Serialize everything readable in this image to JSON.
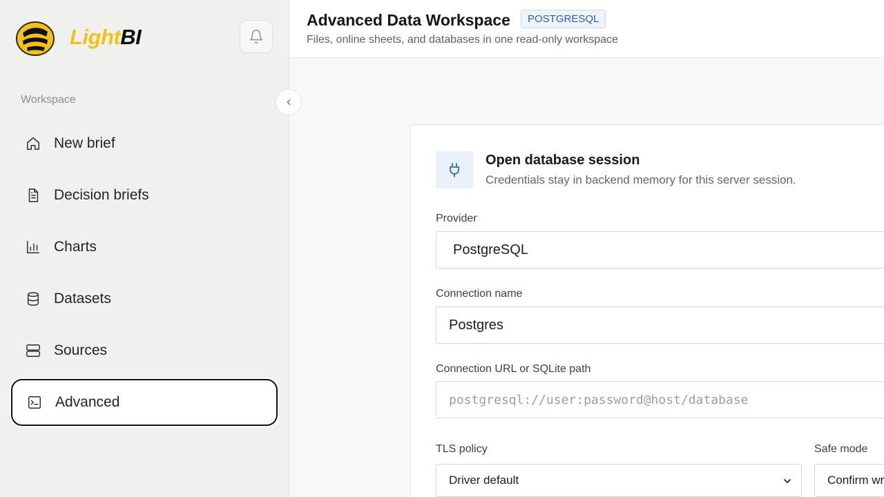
{
  "brand": {
    "name_light": "Light",
    "name_bi": "BI"
  },
  "sidebar": {
    "section_label": "Workspace",
    "items": [
      {
        "label": "New brief",
        "icon": "home-icon"
      },
      {
        "label": "Decision briefs",
        "icon": "document-icon"
      },
      {
        "label": "Charts",
        "icon": "bar-chart-icon"
      },
      {
        "label": "Datasets",
        "icon": "database-icon"
      },
      {
        "label": "Sources",
        "icon": "server-icon"
      },
      {
        "label": "Advanced",
        "icon": "terminal-icon",
        "active": true
      }
    ]
  },
  "header": {
    "title": "Advanced Data Workspace",
    "badge": "POSTGRESQL",
    "subtitle": "Files, online sheets, and databases in one read-only workspace"
  },
  "session_card": {
    "title": "Open database session",
    "subtitle": "Credentials stay in backend memory for this server session.",
    "provider_label": "Provider",
    "provider_value": "PostgreSQL",
    "connection_name_label": "Connection name",
    "connection_name_value": "Postgres",
    "url_label": "Connection URL or SQLite path",
    "url_placeholder": "postgresql://user:password@host/database",
    "tls_label": "TLS policy",
    "tls_value": "Driver default",
    "safe_mode_label": "Safe mode",
    "safe_mode_value": "Confirm writes"
  },
  "colors": {
    "brand_yellow": "#f2c21b",
    "badge_blue": "#2d5fa3",
    "active_border": "#111111"
  }
}
